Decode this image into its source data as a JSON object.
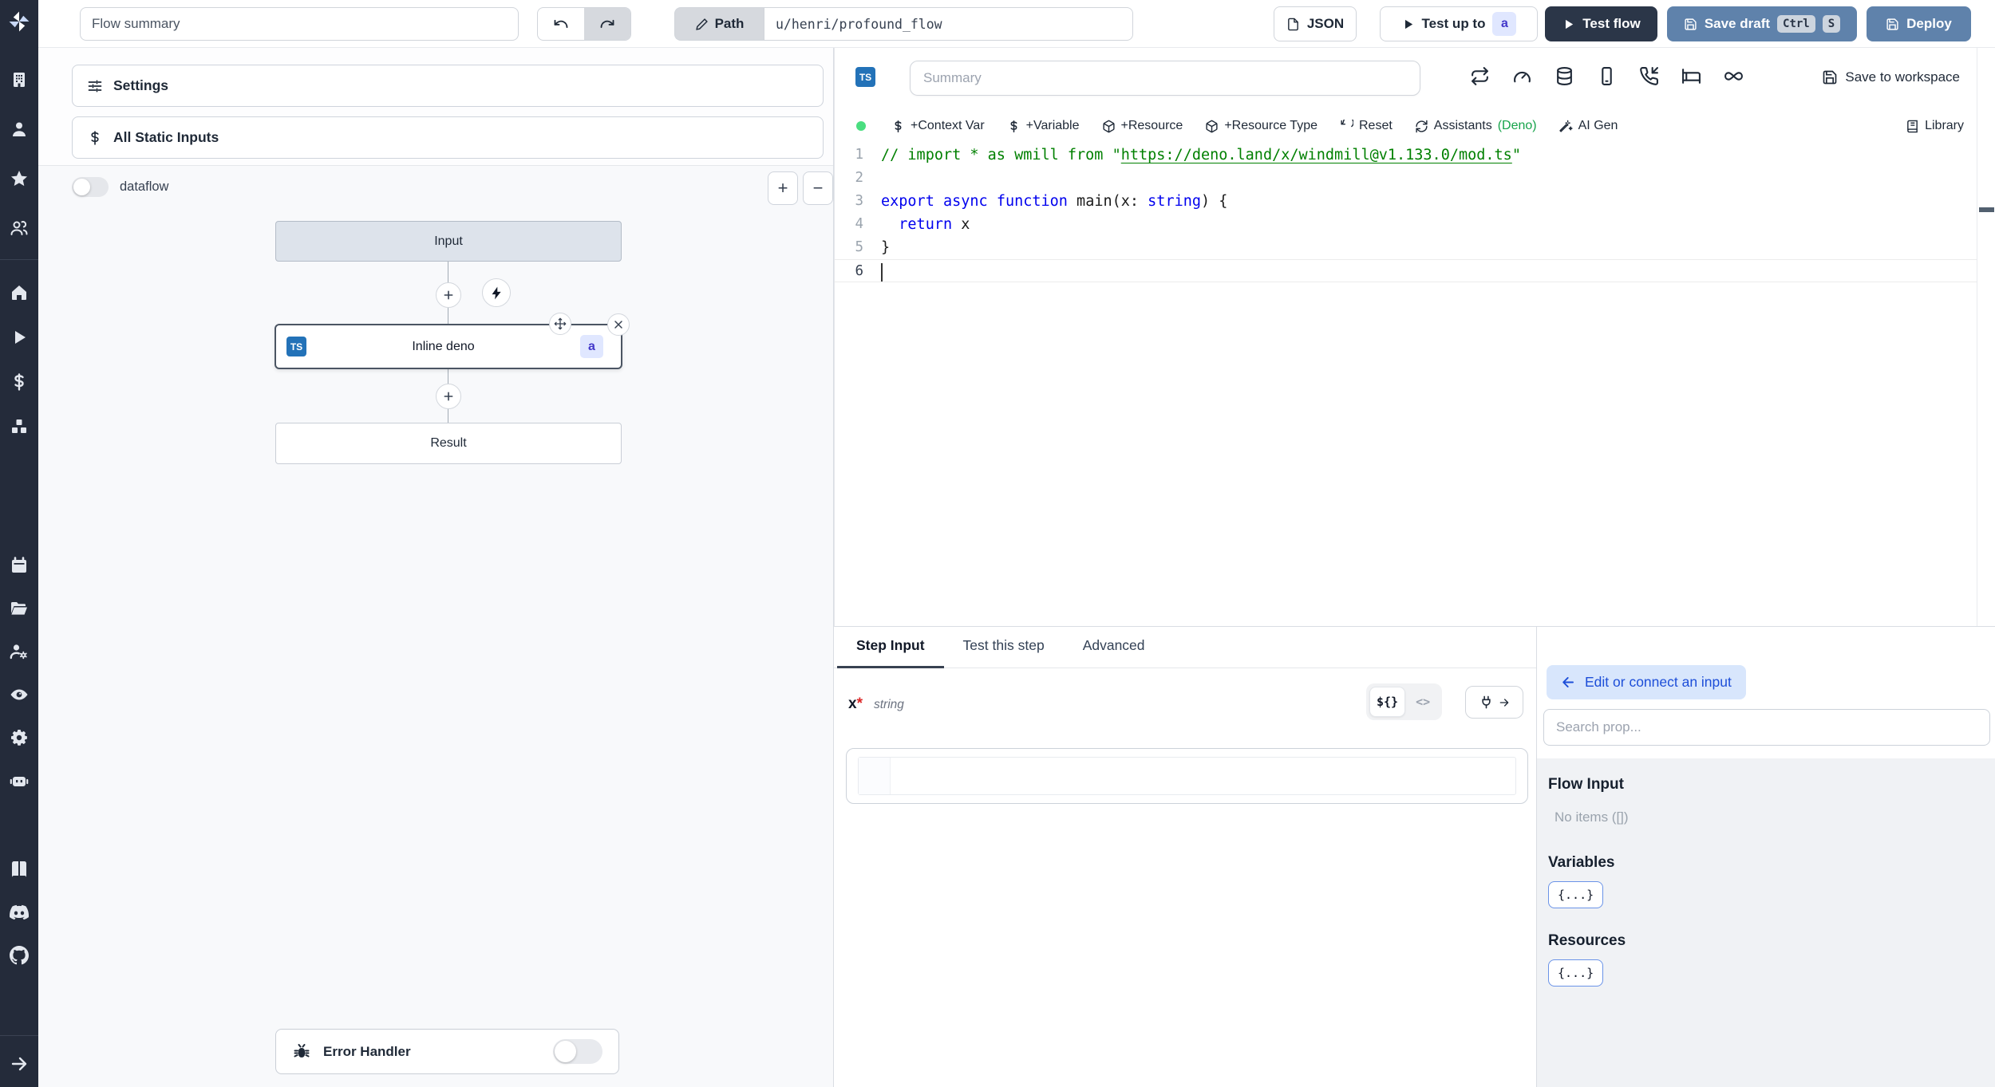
{
  "topbar": {
    "flow_summary_placeholder": "Flow summary",
    "path_label": "Path",
    "path_value": "u/henri/profound_flow",
    "json_label": "JSON",
    "test_up_to_label": "Test up to",
    "test_up_to_badge": "a",
    "test_flow_label": "Test flow",
    "save_draft_label": "Save draft",
    "save_draft_kbd": [
      "Ctrl",
      "S"
    ],
    "deploy_label": "Deploy"
  },
  "sidebar": {
    "icons": [
      "windmill-logo",
      "building",
      "user",
      "star",
      "users",
      "home",
      "play",
      "dollar-sign",
      "boxes",
      "calendar",
      "folder-open",
      "users-cog",
      "eye",
      "settings-gear",
      "robot",
      "book-open",
      "discord",
      "github",
      "arrow-right"
    ]
  },
  "flow_panel": {
    "settings_label": "Settings",
    "static_inputs_label": "All Static Inputs",
    "dataflow_label": "dataflow",
    "zoom_in_label": "+",
    "zoom_out_label": "−",
    "input_node": "Input",
    "step_node": {
      "lang_badge": "TS",
      "label": "Inline deno",
      "id_badge": "a"
    },
    "result_node": "Result",
    "error_handler_label": "Error Handler"
  },
  "editor": {
    "lang_badge": "TS",
    "summary_placeholder": "Summary",
    "save_to_workspace_label": "Save to workspace",
    "toolbar": {
      "context_var": "+Context Var",
      "variable": "+Variable",
      "resource": "+Resource",
      "resource_type": "+Resource Type",
      "reset": "Reset",
      "assistants": "Assistants",
      "assistants_suffix": "(Deno)",
      "ai_gen": "AI Gen",
      "library": "Library"
    },
    "code": {
      "lines": [
        {
          "n": "1",
          "tokens": [
            [
              "// import * as wmill from \"",
              "comment"
            ],
            [
              "https://deno.land/x/windmill@v1.133.0/mod.ts",
              "comment-link"
            ],
            [
              "\"",
              "comment"
            ]
          ]
        },
        {
          "n": "2",
          "tokens": []
        },
        {
          "n": "3",
          "tokens": [
            [
              "export",
              "kw"
            ],
            [
              " ",
              "pl"
            ],
            [
              "async",
              "kw"
            ],
            [
              " ",
              "pl"
            ],
            [
              "function",
              "kw"
            ],
            [
              " main(x: ",
              "pl"
            ],
            [
              "string",
              "kw"
            ],
            [
              ") {",
              "pl"
            ]
          ]
        },
        {
          "n": "4",
          "tokens": [
            [
              "  ",
              "pl"
            ],
            [
              "return",
              "kw"
            ],
            [
              " x",
              "pl"
            ]
          ]
        },
        {
          "n": "5",
          "tokens": [
            [
              "}",
              "pl"
            ]
          ]
        },
        {
          "n": "6",
          "tokens": [],
          "cursor": true,
          "current": true
        }
      ]
    }
  },
  "bottom": {
    "tabs": [
      {
        "label": "Step Input",
        "active": true
      },
      {
        "label": "Test this step",
        "active": false
      },
      {
        "label": "Advanced",
        "active": false
      }
    ],
    "arg": {
      "name": "x",
      "required_marker": "*",
      "type": "string",
      "value": ""
    },
    "expr_toggle": "${}",
    "code_toggle": "<>"
  },
  "prop_panel": {
    "back_label": "Edit or connect an input",
    "search_placeholder": "Search prop...",
    "sections": [
      {
        "title": "Flow Input",
        "empty": "No items ([])"
      },
      {
        "title": "Variables",
        "chip": "{...}"
      },
      {
        "title": "Resources",
        "chip": "{...}"
      }
    ]
  },
  "colors": {
    "sidebar_bg": "#242b3a",
    "primary_button": "#5f82ab",
    "dark_button": "#2b3648",
    "ts_badge": "#2372b8",
    "id_badge_bg": "#e0e7ff",
    "id_badge_text": "#4338ca",
    "green_dot": "#4ade80",
    "deno_green": "#16a34a",
    "code_comment": "#008000",
    "code_keyword": "#0000ee",
    "link_blue": "#1d4ed8"
  }
}
